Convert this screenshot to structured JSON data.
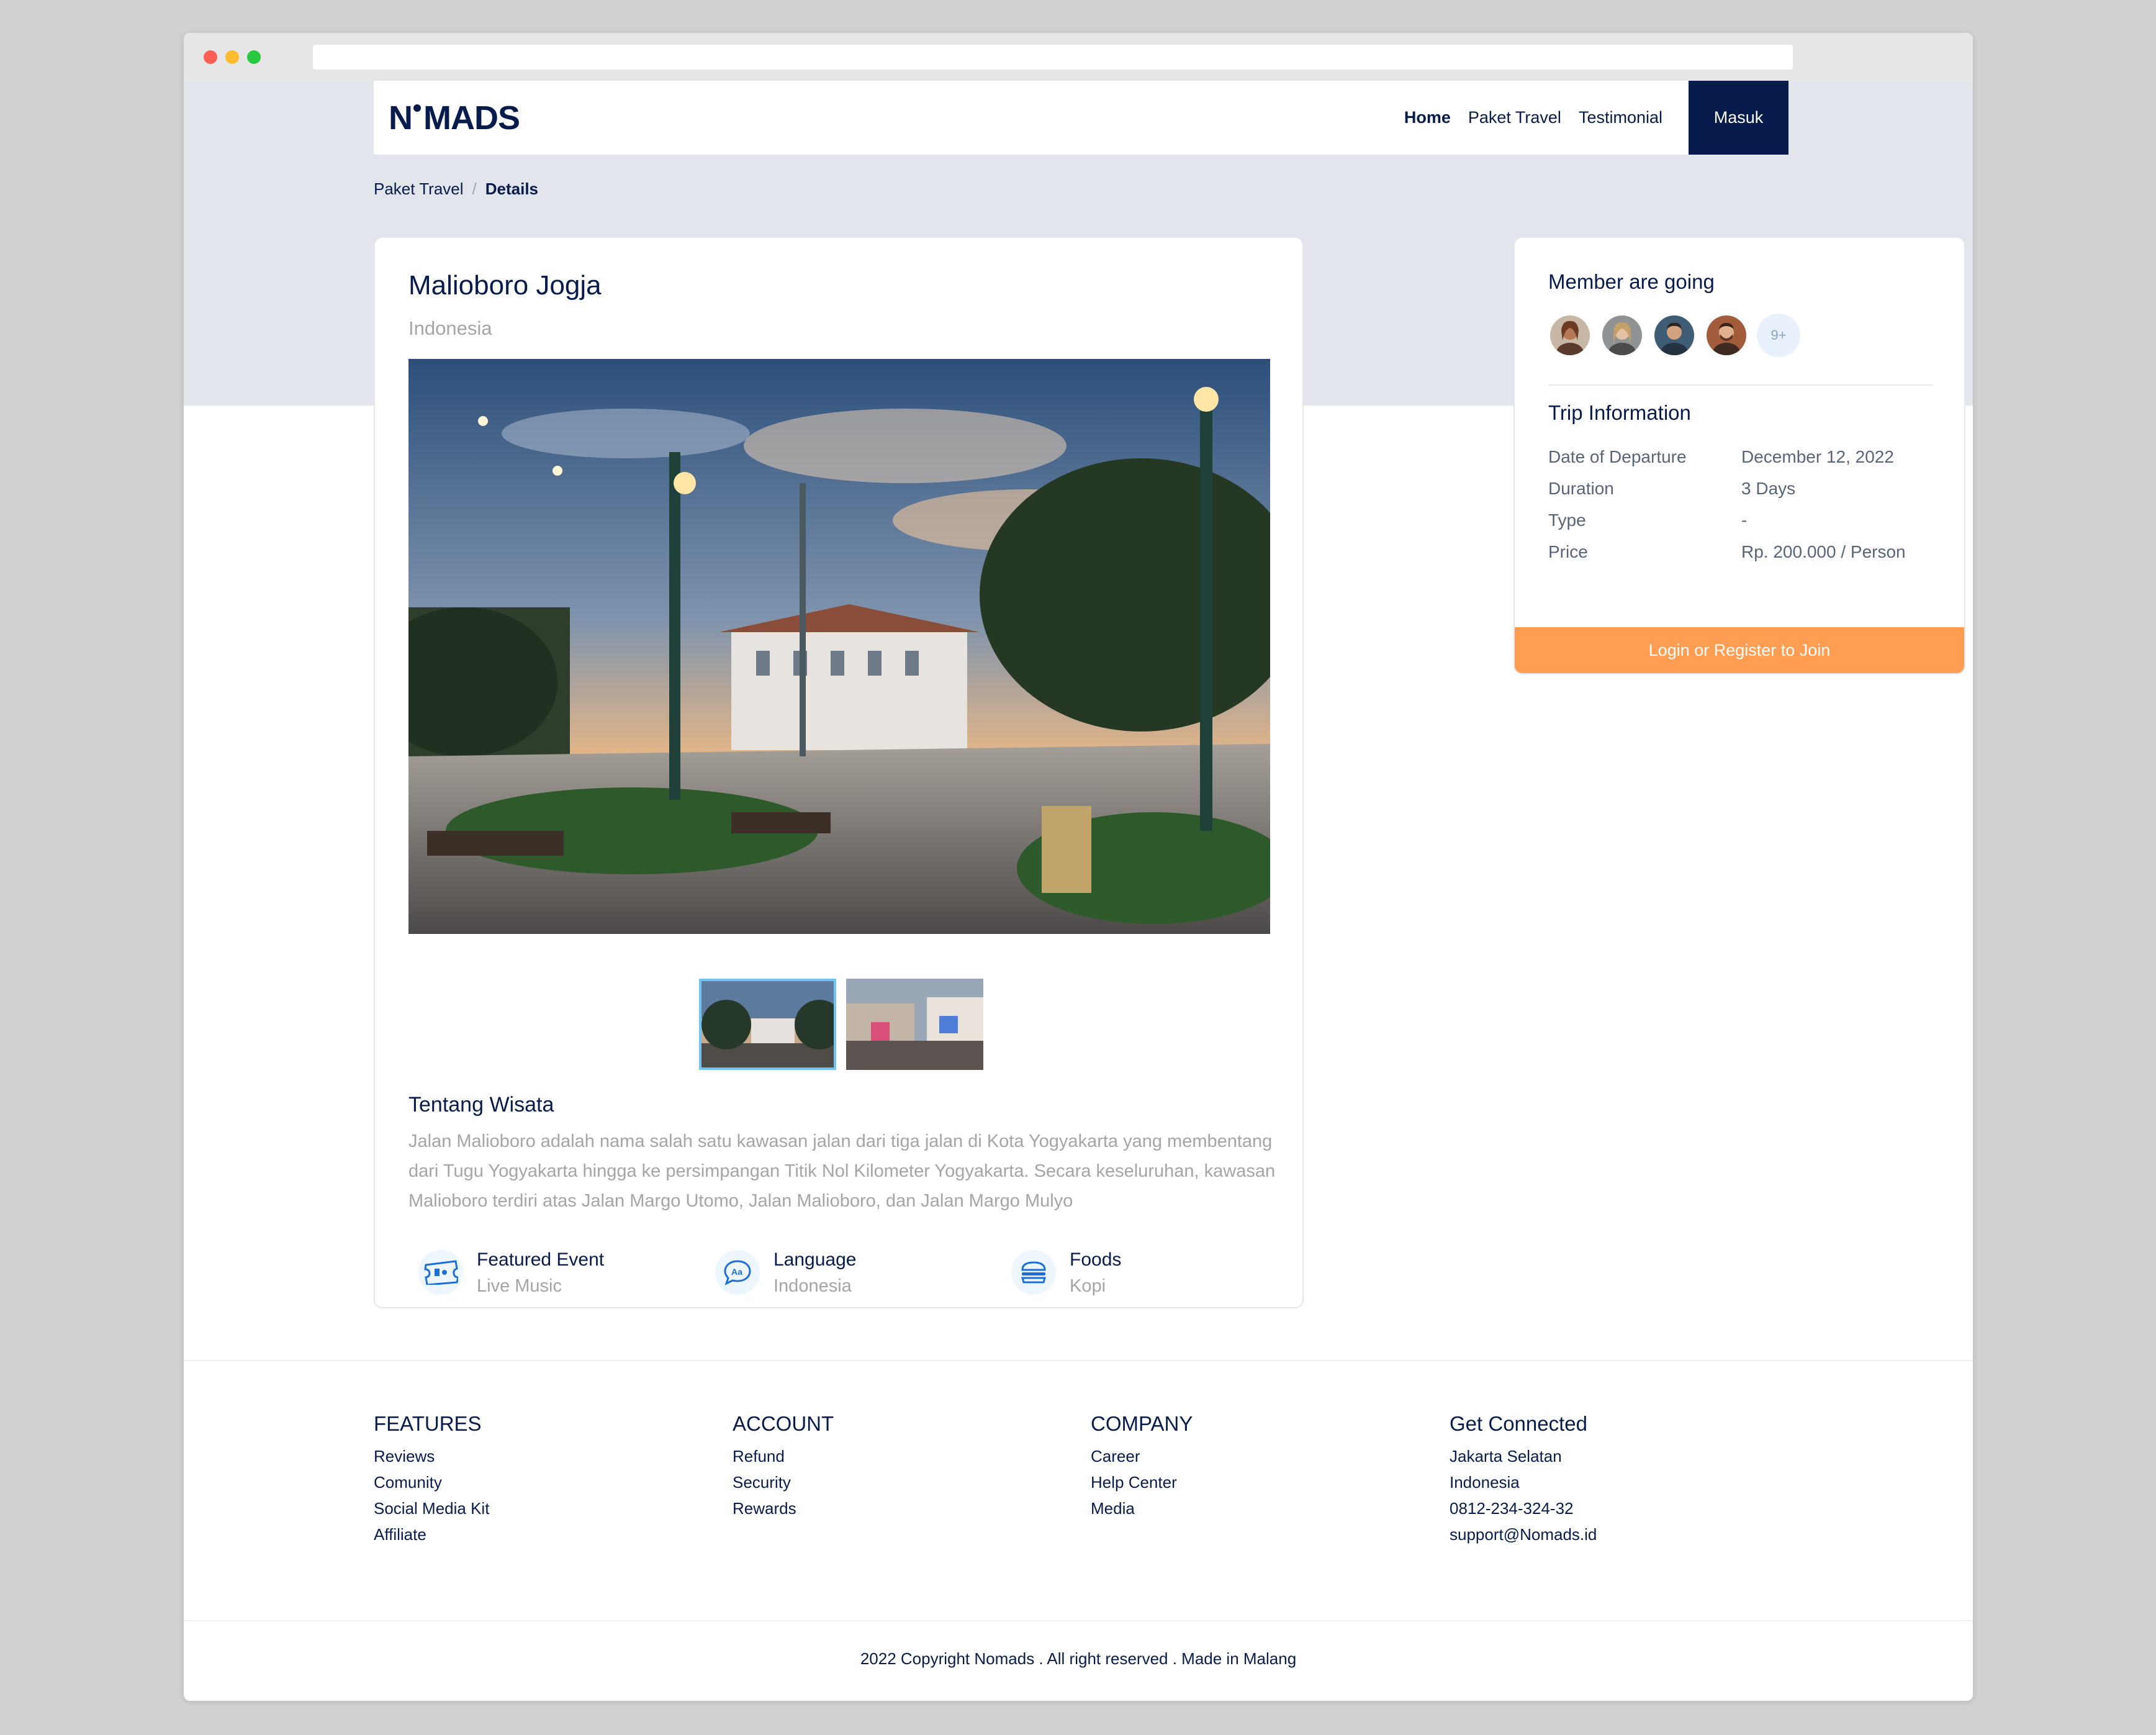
{
  "nav": {
    "logo": "NOMADS",
    "links": [
      "Home",
      "Paket Travel",
      "Testimonial"
    ],
    "login_button": "Masuk"
  },
  "breadcrumb": {
    "parent": "Paket Travel",
    "separator": "/",
    "current": "Details"
  },
  "detail": {
    "title": "Malioboro Jogja",
    "country": "Indonesia",
    "about_title": "Tentang Wisata",
    "about_text": "Jalan Malioboro adalah nama salah satu kawasan jalan dari tiga jalan di Kota Yogyakarta yang membentang dari Tugu Yogyakarta hingga ke persimpangan Titik Nol Kilometer Yogyakarta. Secara keseluruhan, kawasan Malioboro terdiri atas Jalan Margo Utomo, Jalan Malioboro, dan Jalan Margo Mulyo",
    "features": [
      {
        "title": "Featured Event",
        "value": "Live Music",
        "icon": "ticket-icon"
      },
      {
        "title": "Language",
        "value": "Indonesia",
        "icon": "chat-language-icon"
      },
      {
        "title": "Foods",
        "value": "Kopi",
        "icon": "burger-icon"
      }
    ]
  },
  "sidebar": {
    "members_title": "Member are going",
    "more_members": "9+",
    "trip_title": "Trip Information",
    "trip": [
      {
        "label": "Date of Departure",
        "value": "December 12, 2022"
      },
      {
        "label": "Duration",
        "value": "3 Days"
      },
      {
        "label": "Type",
        "value": "-"
      },
      {
        "label": "Price",
        "value": "Rp. 200.000 / Person"
      }
    ],
    "join_button": "Login or Register to Join"
  },
  "footer": {
    "columns": [
      {
        "title": "FEATURES",
        "items": [
          "Reviews",
          "Comunity",
          "Social Media Kit",
          "Affiliate"
        ]
      },
      {
        "title": "ACCOUNT",
        "items": [
          "Refund",
          "Security",
          "Rewards"
        ]
      },
      {
        "title": "COMPANY",
        "items": [
          "Career",
          "Help Center",
          "Media"
        ]
      },
      {
        "title": "Get Connected",
        "items": [
          "Jakarta Selatan",
          "Indonesia",
          "0812-234-324-32",
          "support@Nomads.id"
        ]
      }
    ],
    "copyright": "2022 Copyright Nomads . All right reserved . Made in Malang"
  },
  "colors": {
    "primary": "#071c4d",
    "accent": "#ff9e53",
    "hero_bg": "#e2e5eb"
  }
}
